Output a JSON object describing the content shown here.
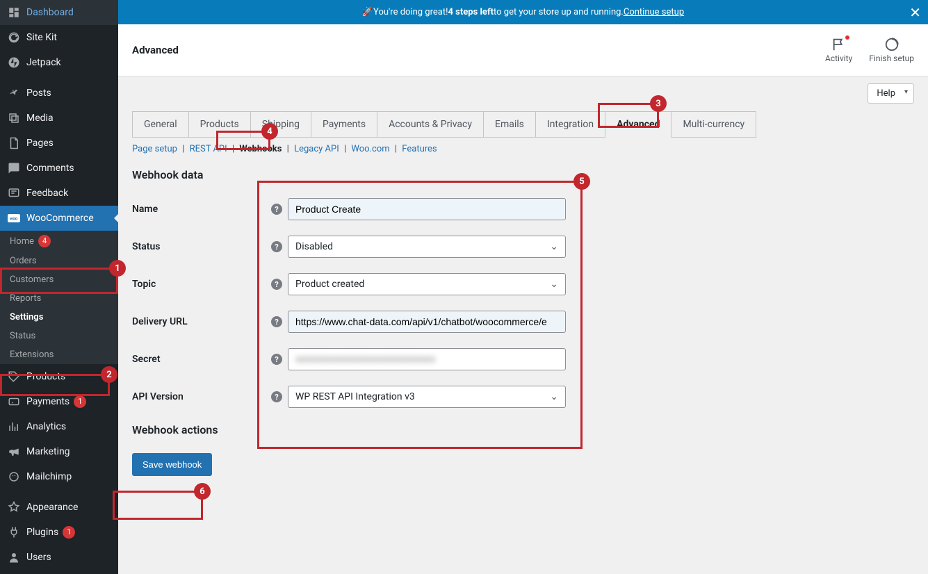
{
  "banner": {
    "emoji": "🚀",
    "text_pre": " You're doing great! ",
    "bold": "4 steps left",
    "text_post": " to get your store up and running. ",
    "link": "Continue setup"
  },
  "topbar": {
    "title": "Advanced",
    "activity": "Activity",
    "finish": "Finish setup",
    "help": "Help"
  },
  "sidebar": {
    "dashboard": "Dashboard",
    "sitekit": "Site Kit",
    "jetpack": "Jetpack",
    "posts": "Posts",
    "media": "Media",
    "pages": "Pages",
    "comments": "Comments",
    "feedback": "Feedback",
    "woocommerce": "WooCommerce",
    "products": "Products",
    "payments": "Payments",
    "payments_badge": "1",
    "analytics": "Analytics",
    "marketing": "Marketing",
    "mailchimp": "Mailchimp",
    "appearance": "Appearance",
    "plugins": "Plugins",
    "plugins_badge": "1",
    "users": "Users"
  },
  "woosub": {
    "home": "Home",
    "home_badge": "4",
    "orders": "Orders",
    "customers": "Customers",
    "reports": "Reports",
    "settings": "Settings",
    "status": "Status",
    "extensions": "Extensions"
  },
  "tabs": {
    "general": "General",
    "products": "Products",
    "shipping": "Shipping",
    "payments": "Payments",
    "accounts": "Accounts & Privacy",
    "emails": "Emails",
    "integration": "Integration",
    "advanced": "Advanced",
    "multicurrency": "Multi-currency"
  },
  "subtabs": {
    "page_setup": "Page setup",
    "rest_api": "REST API",
    "webhooks": "Webhooks",
    "legacy_api": "Legacy API",
    "woo_com": "Woo.com",
    "features": "Features"
  },
  "form": {
    "heading": "Webhook data",
    "name_label": "Name",
    "name_value": "Product Create",
    "status_label": "Status",
    "status_value": "Disabled",
    "topic_label": "Topic",
    "topic_value": "Product created",
    "delivery_label": "Delivery URL",
    "delivery_value": "https://www.chat-data.com/api/v1/chatbot/woocommerce/e",
    "secret_label": "Secret",
    "secret_value": "xxxxxxxxxxxxxxxxxxxxxxxxxxxxx",
    "api_label": "API Version",
    "api_value": "WP REST API Integration v3",
    "actions_heading": "Webhook actions",
    "save": "Save webhook"
  },
  "callouts": {
    "c1": "1",
    "c2": "2",
    "c3": "3",
    "c4": "4",
    "c5": "5",
    "c6": "6"
  }
}
